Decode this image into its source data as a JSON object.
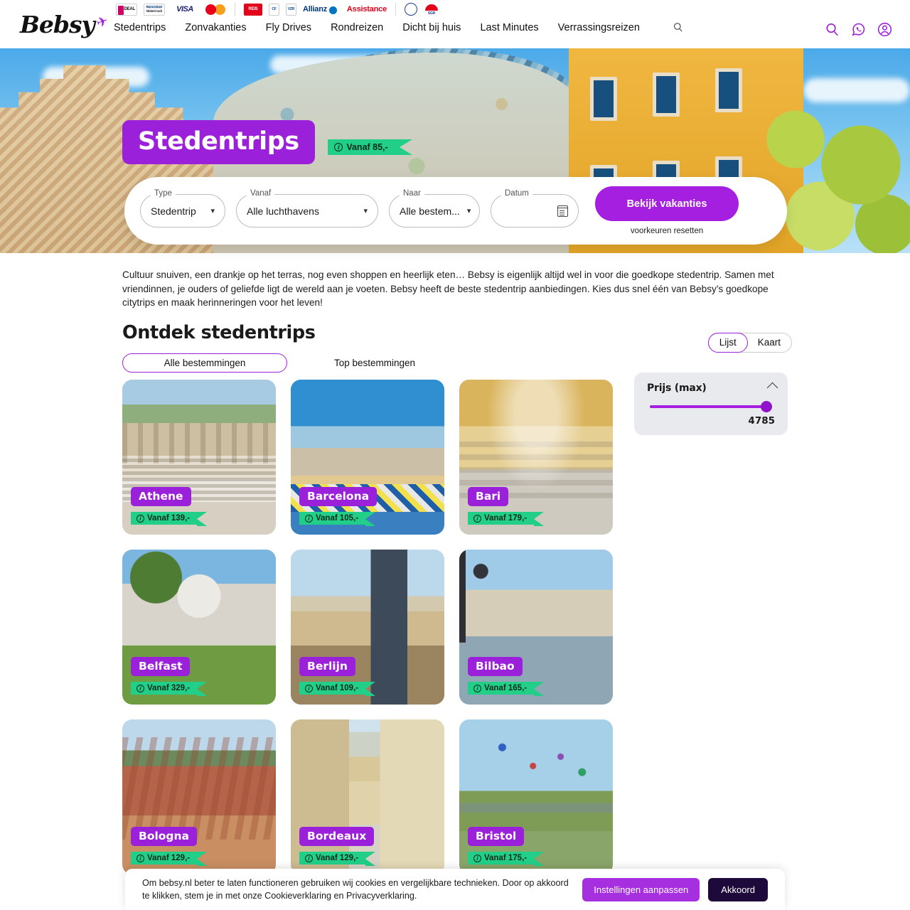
{
  "header": {
    "logo_text": "Bebsy",
    "logo_icon": "airplane-icon",
    "trust_logos": [
      {
        "name": "ideal-logo",
        "label": "iDEAL"
      },
      {
        "name": "bancontact-mistercash-logo",
        "label": "Bancontact Mister Cash"
      },
      {
        "name": "visa-logo",
        "label": "VISA"
      },
      {
        "name": "mastercard-logo",
        "label": "Mastercard"
      },
      {
        "name": "reisgarantie-logo",
        "label": "REIS"
      },
      {
        "name": "calamiteitenfonds-logo",
        "label": "Calamiteitenfonds"
      },
      {
        "name": "vzr-garant-logo",
        "label": "VZR Garant"
      },
      {
        "name": "allianz-assistance-logo",
        "label": "Allianz Assistance"
      },
      {
        "name": "anvr-logo",
        "label": "ANVR"
      },
      {
        "name": "sgr-logo",
        "label": "SGR"
      }
    ],
    "nav": [
      {
        "label": "Stedentrips"
      },
      {
        "label": "Zonvakanties"
      },
      {
        "label": "Fly Drives"
      },
      {
        "label": "Rondreizen"
      },
      {
        "label": "Dicht bij huis"
      },
      {
        "label": "Last Minutes"
      },
      {
        "label": "Verrassingsreizen"
      }
    ],
    "icons": [
      "search-icon",
      "whatsapp-icon",
      "account-icon"
    ]
  },
  "hero": {
    "title": "Stedentrips",
    "price_ribbon": "Vanaf 85,-"
  },
  "search": {
    "fields": [
      {
        "label": "Type",
        "value": "Stedentrip",
        "name": "type-select"
      },
      {
        "label": "Vanaf",
        "value": "Alle luchthavens",
        "name": "departure-select"
      },
      {
        "label": "Naar",
        "value": "Alle bestem...",
        "name": "destination-select"
      },
      {
        "label": "Datum",
        "value": "",
        "name": "date-input"
      }
    ],
    "cta_label": "Bekijk vakanties",
    "reset_label": "voorkeuren resetten"
  },
  "intro": {
    "paragraph": "Cultuur snuiven, een drankje op het terras, nog even shoppen en heerlijk eten… Bebsy is eigenlijk altijd wel in voor die goedkope stedentrip. Samen met vriendinnen, je ouders of geliefde ligt de wereld aan je voeten. Bebsy heeft de beste stedentrip aanbiedingen. Kies dus snel één van Bebsy's goedkope citytrips en maak herinneringen voor het leven!"
  },
  "discover": {
    "title": "Ontdek stedentrips",
    "tabs": [
      {
        "label": "Alle bestemmingen",
        "active": true
      },
      {
        "label": "Top bestemmingen",
        "active": false
      }
    ],
    "view_toggle": [
      {
        "label": "Lijst",
        "active": true
      },
      {
        "label": "Kaart",
        "active": false
      }
    ],
    "filter": {
      "title": "Prijs (max)",
      "value": "4785",
      "collapse_icon": "chevron-up-icon"
    },
    "cards": [
      {
        "city": "Athene",
        "price": "Vanaf 139,-",
        "photo": "ph-athene"
      },
      {
        "city": "Barcelona",
        "price": "Vanaf 105,-",
        "photo": "ph-barcelona"
      },
      {
        "city": "Bari",
        "price": "Vanaf 179,-",
        "photo": "ph-bari"
      },
      {
        "city": "Belfast",
        "price": "Vanaf 329,-",
        "photo": "ph-belfast"
      },
      {
        "city": "Berlijn",
        "price": "Vanaf 109,-",
        "photo": "ph-berlijn"
      },
      {
        "city": "Bilbao",
        "price": "Vanaf 165,-",
        "photo": "ph-bilbao"
      },
      {
        "city": "Bologna",
        "price": "Vanaf 129,-",
        "photo": "ph-bologna"
      },
      {
        "city": "Bordeaux",
        "price": "Vanaf 129,-",
        "photo": "ph-bordeaux"
      },
      {
        "city": "Bristol",
        "price": "Vanaf 175,-",
        "photo": "ph-bristol"
      }
    ]
  },
  "cookie": {
    "text": "Om bebsy.nl beter te laten functioneren gebruiken wij cookies en vergelijkbare technieken. Door op akkoord te klikken, stem je in met onze Cookieverklaring en Privacyverklaring.",
    "settings_label": "Instellingen aanpassen",
    "accept_label": "Akkoord"
  },
  "colors": {
    "purple": "#9b20d9",
    "purple_cta": "#a51fe0",
    "green": "#22cf88",
    "dark_navy": "#1d0a3a"
  }
}
